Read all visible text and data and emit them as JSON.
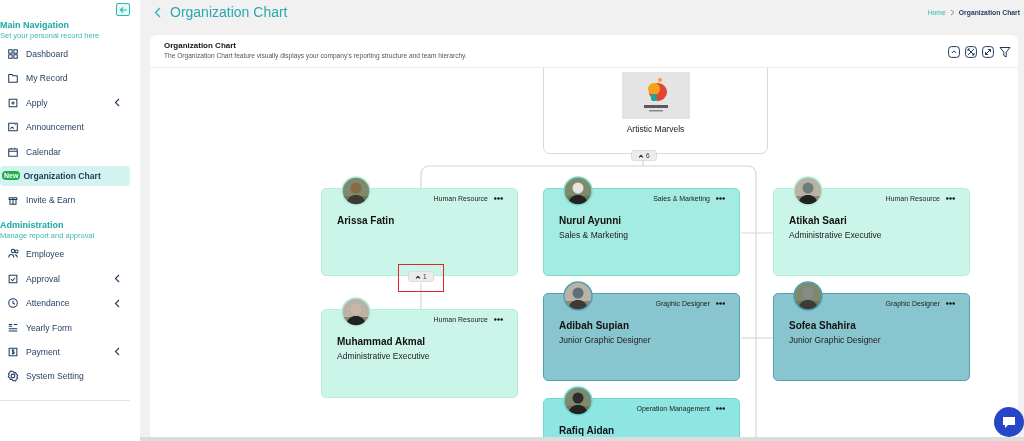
{
  "sidebar": {
    "sections": [
      {
        "title": "Main Navigation",
        "subtitle": "Set your personal record here",
        "items": [
          {
            "label": "Dashboard",
            "selected": false,
            "has_submenu": false
          },
          {
            "label": "My Record",
            "selected": false,
            "has_submenu": false
          },
          {
            "label": "Apply",
            "selected": false,
            "has_submenu": true
          },
          {
            "label": "Announcement",
            "selected": false,
            "has_submenu": false
          },
          {
            "label": "Calendar",
            "selected": false,
            "has_submenu": false
          },
          {
            "label": "Organization Chart",
            "selected": true,
            "has_submenu": false,
            "badge": "New"
          },
          {
            "label": "Invite & Earn",
            "selected": false,
            "has_submenu": false
          }
        ]
      },
      {
        "title": "Administration",
        "subtitle": "Manage report and approval",
        "items": [
          {
            "label": "Employee",
            "selected": false,
            "has_submenu": false
          },
          {
            "label": "Approval",
            "selected": false,
            "has_submenu": true
          },
          {
            "label": "Attendance",
            "selected": false,
            "has_submenu": true
          },
          {
            "label": "Yearly Form",
            "selected": false,
            "has_submenu": false
          },
          {
            "label": "Payment",
            "selected": false,
            "has_submenu": true
          },
          {
            "label": "System Setting",
            "selected": false,
            "has_submenu": false
          }
        ]
      }
    ]
  },
  "page": {
    "title": "Organization Chart",
    "breadcrumb": [
      "Home",
      "Organization Chart"
    ]
  },
  "card": {
    "title": "Organization Chart",
    "description": "The Organization Chart feature visually displays your company's reporting structure and team hierarchy."
  },
  "chart": {
    "root": {
      "name": "Artistic Marvels",
      "toggle": {
        "count": "6"
      }
    },
    "employees": [
      {
        "name": "Arissa Fatin",
        "department": "Human Resource",
        "color": "#ccf5e9",
        "toggle": {
          "count": "1",
          "highlighted": true
        }
      },
      {
        "name": "Muhammad Akmal",
        "title": "Administrative Executive",
        "department": "Human Resource",
        "color": "#ccf5e9"
      },
      {
        "name": "Nurul Ayunni",
        "title": "Sales & Marketing",
        "department": "Sales & Marketing",
        "color": "#a4ebe2"
      },
      {
        "name": "Adibah Supian",
        "title": "Junior Graphic Designer",
        "department": "Graphic Designer",
        "color": "#89c5cf"
      },
      {
        "name": "Rafiq Aidan",
        "department": "Operation Management",
        "color": "#8ee6e3"
      },
      {
        "name": "Atikah Saari",
        "title": "Administrative Executive",
        "department": "Human Resource",
        "color": "#ccf5e9"
      },
      {
        "name": "Sofea Shahira",
        "title": "Junior Graphic Designer",
        "department": "Graphic Designer",
        "color": "#89c5cf"
      }
    ]
  }
}
